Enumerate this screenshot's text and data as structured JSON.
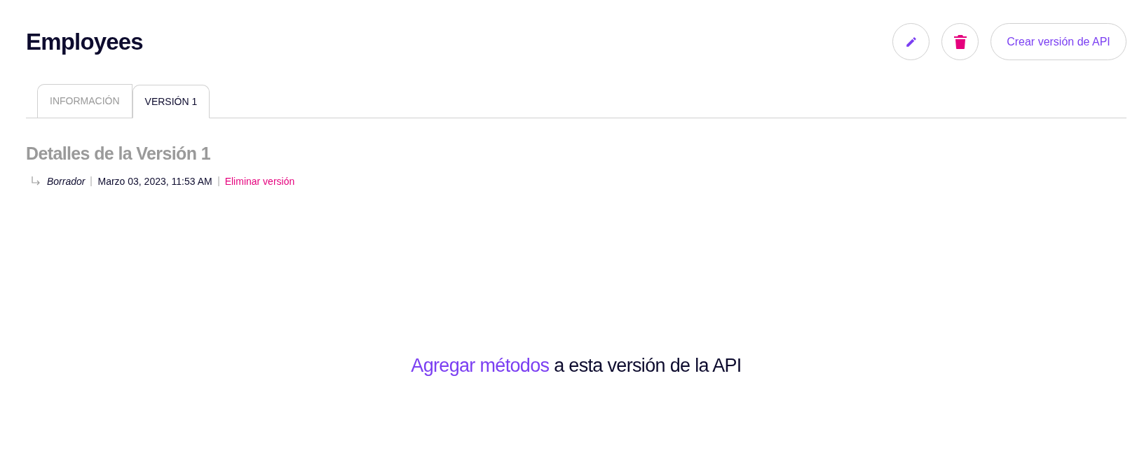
{
  "page": {
    "title": "Employees"
  },
  "actions": [
    {
      "kind": "edit"
    },
    {
      "kind": "delete"
    },
    {
      "kind": "text",
      "label": "Crear versión de API"
    }
  ],
  "tabs": [
    {
      "label": "INFORMACIÓN",
      "selected": false
    },
    {
      "label": "VERSIÓN 1",
      "selected": true
    }
  ],
  "version": {
    "heading": "Detalles de la Versión 1",
    "status": "Borrador",
    "date": "Marzo 03, 2023, 11:53 AM",
    "delete_link": "Eliminar versión"
  },
  "empty_state": {
    "link": "Agregar métodos",
    "text": "a esta versión de la API"
  }
}
